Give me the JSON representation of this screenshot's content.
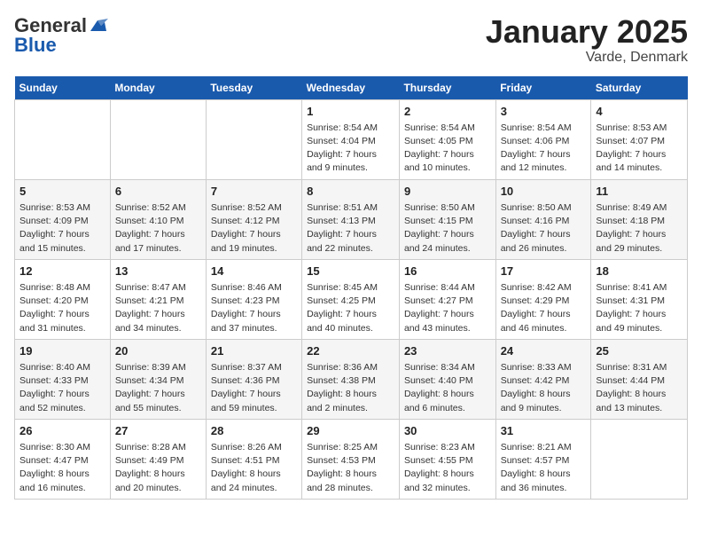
{
  "logo": {
    "general": "General",
    "blue": "Blue"
  },
  "title": "January 2025",
  "subtitle": "Varde, Denmark",
  "headers": [
    "Sunday",
    "Monday",
    "Tuesday",
    "Wednesday",
    "Thursday",
    "Friday",
    "Saturday"
  ],
  "weeks": [
    [
      {
        "day": "",
        "info": ""
      },
      {
        "day": "",
        "info": ""
      },
      {
        "day": "",
        "info": ""
      },
      {
        "day": "1",
        "info": "Sunrise: 8:54 AM\nSunset: 4:04 PM\nDaylight: 7 hours\nand 9 minutes."
      },
      {
        "day": "2",
        "info": "Sunrise: 8:54 AM\nSunset: 4:05 PM\nDaylight: 7 hours\nand 10 minutes."
      },
      {
        "day": "3",
        "info": "Sunrise: 8:54 AM\nSunset: 4:06 PM\nDaylight: 7 hours\nand 12 minutes."
      },
      {
        "day": "4",
        "info": "Sunrise: 8:53 AM\nSunset: 4:07 PM\nDaylight: 7 hours\nand 14 minutes."
      }
    ],
    [
      {
        "day": "5",
        "info": "Sunrise: 8:53 AM\nSunset: 4:09 PM\nDaylight: 7 hours\nand 15 minutes."
      },
      {
        "day": "6",
        "info": "Sunrise: 8:52 AM\nSunset: 4:10 PM\nDaylight: 7 hours\nand 17 minutes."
      },
      {
        "day": "7",
        "info": "Sunrise: 8:52 AM\nSunset: 4:12 PM\nDaylight: 7 hours\nand 19 minutes."
      },
      {
        "day": "8",
        "info": "Sunrise: 8:51 AM\nSunset: 4:13 PM\nDaylight: 7 hours\nand 22 minutes."
      },
      {
        "day": "9",
        "info": "Sunrise: 8:50 AM\nSunset: 4:15 PM\nDaylight: 7 hours\nand 24 minutes."
      },
      {
        "day": "10",
        "info": "Sunrise: 8:50 AM\nSunset: 4:16 PM\nDaylight: 7 hours\nand 26 minutes."
      },
      {
        "day": "11",
        "info": "Sunrise: 8:49 AM\nSunset: 4:18 PM\nDaylight: 7 hours\nand 29 minutes."
      }
    ],
    [
      {
        "day": "12",
        "info": "Sunrise: 8:48 AM\nSunset: 4:20 PM\nDaylight: 7 hours\nand 31 minutes."
      },
      {
        "day": "13",
        "info": "Sunrise: 8:47 AM\nSunset: 4:21 PM\nDaylight: 7 hours\nand 34 minutes."
      },
      {
        "day": "14",
        "info": "Sunrise: 8:46 AM\nSunset: 4:23 PM\nDaylight: 7 hours\nand 37 minutes."
      },
      {
        "day": "15",
        "info": "Sunrise: 8:45 AM\nSunset: 4:25 PM\nDaylight: 7 hours\nand 40 minutes."
      },
      {
        "day": "16",
        "info": "Sunrise: 8:44 AM\nSunset: 4:27 PM\nDaylight: 7 hours\nand 43 minutes."
      },
      {
        "day": "17",
        "info": "Sunrise: 8:42 AM\nSunset: 4:29 PM\nDaylight: 7 hours\nand 46 minutes."
      },
      {
        "day": "18",
        "info": "Sunrise: 8:41 AM\nSunset: 4:31 PM\nDaylight: 7 hours\nand 49 minutes."
      }
    ],
    [
      {
        "day": "19",
        "info": "Sunrise: 8:40 AM\nSunset: 4:33 PM\nDaylight: 7 hours\nand 52 minutes."
      },
      {
        "day": "20",
        "info": "Sunrise: 8:39 AM\nSunset: 4:34 PM\nDaylight: 7 hours\nand 55 minutes."
      },
      {
        "day": "21",
        "info": "Sunrise: 8:37 AM\nSunset: 4:36 PM\nDaylight: 7 hours\nand 59 minutes."
      },
      {
        "day": "22",
        "info": "Sunrise: 8:36 AM\nSunset: 4:38 PM\nDaylight: 8 hours\nand 2 minutes."
      },
      {
        "day": "23",
        "info": "Sunrise: 8:34 AM\nSunset: 4:40 PM\nDaylight: 8 hours\nand 6 minutes."
      },
      {
        "day": "24",
        "info": "Sunrise: 8:33 AM\nSunset: 4:42 PM\nDaylight: 8 hours\nand 9 minutes."
      },
      {
        "day": "25",
        "info": "Sunrise: 8:31 AM\nSunset: 4:44 PM\nDaylight: 8 hours\nand 13 minutes."
      }
    ],
    [
      {
        "day": "26",
        "info": "Sunrise: 8:30 AM\nSunset: 4:47 PM\nDaylight: 8 hours\nand 16 minutes."
      },
      {
        "day": "27",
        "info": "Sunrise: 8:28 AM\nSunset: 4:49 PM\nDaylight: 8 hours\nand 20 minutes."
      },
      {
        "day": "28",
        "info": "Sunrise: 8:26 AM\nSunset: 4:51 PM\nDaylight: 8 hours\nand 24 minutes."
      },
      {
        "day": "29",
        "info": "Sunrise: 8:25 AM\nSunset: 4:53 PM\nDaylight: 8 hours\nand 28 minutes."
      },
      {
        "day": "30",
        "info": "Sunrise: 8:23 AM\nSunset: 4:55 PM\nDaylight: 8 hours\nand 32 minutes."
      },
      {
        "day": "31",
        "info": "Sunrise: 8:21 AM\nSunset: 4:57 PM\nDaylight: 8 hours\nand 36 minutes."
      },
      {
        "day": "",
        "info": ""
      }
    ]
  ]
}
